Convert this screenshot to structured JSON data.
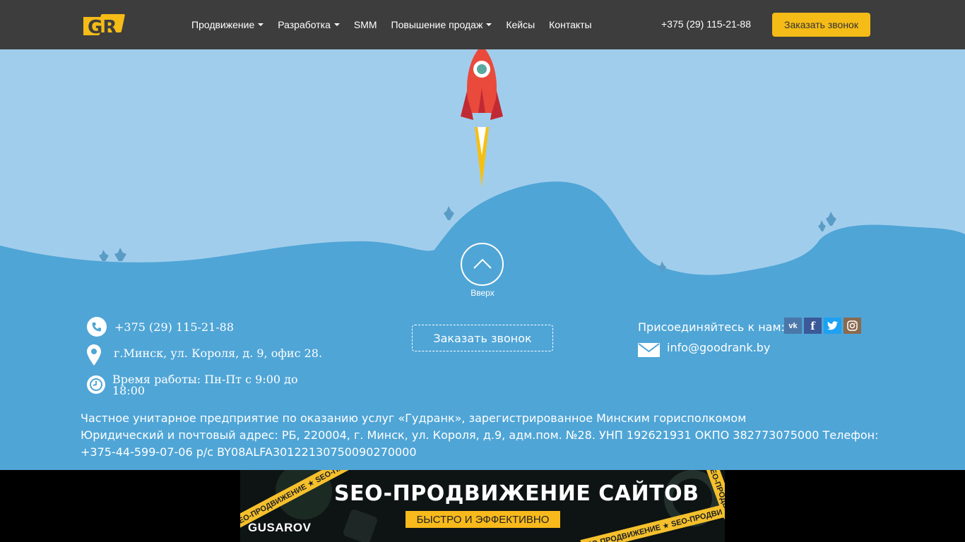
{
  "header": {
    "logo_text": "GR",
    "nav": [
      {
        "label": "Продвижение",
        "has_dropdown": true
      },
      {
        "label": "Разработка",
        "has_dropdown": true
      },
      {
        "label": "SMM",
        "has_dropdown": false
      },
      {
        "label": "Повышение продаж",
        "has_dropdown": true
      },
      {
        "label": "Кейсы",
        "has_dropdown": false
      },
      {
        "label": "Контакты",
        "has_dropdown": false
      }
    ],
    "phone": "+375 (29) 115-21-88",
    "call_button": "Заказать звонок"
  },
  "hero": {
    "up_label": "Вверх",
    "icons": [
      "rocket-icon",
      "chevron-up-icon"
    ]
  },
  "footer": {
    "phone": "+375 (29) 115-21-88",
    "address": "г.Минск, ул. Короля, д. 9, офис 28.",
    "hours_line1": "Время работы: Пн-Пт с 9:00 до",
    "hours_line2": "18:00",
    "order_button": "Заказать звонок",
    "join_label": "Присоединяйтесь к нам:",
    "social": [
      {
        "name": "vk",
        "glyph": "vk",
        "color": "#4a76a8"
      },
      {
        "name": "facebook",
        "glyph": "f",
        "color": "#3b5998"
      },
      {
        "name": "twitter",
        "glyph": "t",
        "color": "#1da1f2"
      },
      {
        "name": "instagram",
        "glyph": "◎",
        "color": "#8a6a4f"
      }
    ],
    "email": "info@goodrank.by",
    "legal_line1": "Частное унитарное предприятие по оказанию услуг «Гудранк», зарегистрированное Минским горисполкомом",
    "legal_line2": "Юридический и почтовый адрес: РБ, 220004, г. Минск, ул. Короля, д.9, адм.пом. №28. УНП 192621931 ОКПО 382773075000 Телефон: +375-44-599-07-06 р/с BY08ALFA30122130750090270000"
  },
  "banner": {
    "title": "SEO-ПРОДВИЖЕНИЕ САЙТОВ",
    "subtitle": "БЫСТРО И ЭФФЕКТИВНО",
    "brand": "GUSAROV",
    "tape_text": "SEO-ПРОДВИЖЕНИЕ ★ SEO-ПРОДВИЖЕНИЕ ★ SEO-ПРОДВИЖЕНИЕ ★ SEO-ПРОДВИЖЕНИЕ"
  },
  "colors": {
    "header_bg": "#3d3d3d",
    "accent": "#f5bb17",
    "sky": "#a1cdec",
    "ground": "#4fa5d6",
    "rocket": "#e94a3c"
  }
}
